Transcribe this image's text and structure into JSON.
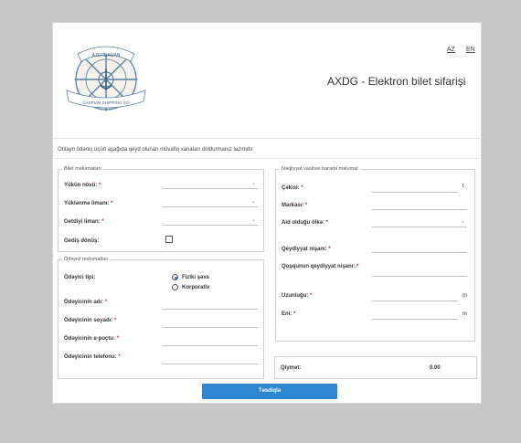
{
  "header": {
    "app_title": "AXDG - Elektron bilet sifarişi",
    "lang_az": "AZ",
    "lang_en": "EN",
    "logo": {
      "top_text": "AZERBAIJAN",
      "bottom_text": "CASPIAN SHIPPING CO"
    }
  },
  "intro_text": "Onlayn ödəniş üçün aşağıda qeyd olunan müvafiq xanaları doldurmanız lazımdır",
  "bilet": {
    "legend": "Bilet məlumatları",
    "yukun_novu": "Yükün növü:",
    "yuklenme_limani": "Yüklənmə limanı:",
    "getdiyi_liman": "Getdiyi liman:",
    "gedis_donus": "Gediş dönüş:",
    "required_mark": "*"
  },
  "odeyici": {
    "legend": "Ödəyici məlumatları",
    "tipi": "Ödəyici tipi:",
    "option_fiziki": "Fiziki şəxs",
    "option_korporativ": "Korporativ",
    "adi": "Ödəyicinin adı:",
    "soyadi": "Ödəyicinin soyadı:",
    "email": "Ödəyicinin e-poçtu:",
    "telefon": "Ödəyicinin telefonu:"
  },
  "neqliyyat": {
    "legend": "Nəqliyyat vasitəsi barədə məlumat",
    "cekisi": "Çəkisi:",
    "cekisi_unit": "t",
    "markasi": "Markası:",
    "aid_olke": "Aid olduğu ölkə:",
    "qeydiyyat_nisani": "Qeydiyyat nişanı:",
    "qosqun_nisani": "Qoşqunun qeydiyyat nişanı:",
    "uzunlugu": "Uzunluğu:",
    "uzunlugu_unit": "m",
    "eni": "Eni:",
    "eni_unit": "m"
  },
  "qiymet": {
    "label": "Qiymət:",
    "value": "0.00"
  },
  "submit_label": "Təsdiqlə"
}
